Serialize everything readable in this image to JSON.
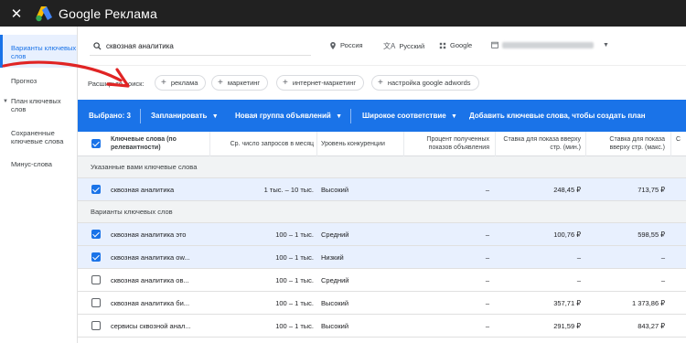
{
  "app": {
    "title": "Google Реклама"
  },
  "sidebar": {
    "items": [
      {
        "label": "Варианты ключевых слов",
        "active": true
      },
      {
        "label": "Прогноз"
      },
      {
        "label": "План ключевых слов"
      },
      {
        "label": "Сохраненные ключевые слова"
      },
      {
        "label": "Минус-слова"
      }
    ]
  },
  "search": {
    "query": "сквозная аналитика",
    "location": "Россия",
    "language": "Русский",
    "network": "Google"
  },
  "expand": {
    "label": "Расширьте поиск:",
    "chips": [
      "реклама",
      "маркетинг",
      "интернет-маркетинг",
      "настройка google adwords"
    ]
  },
  "toolbar": {
    "selected": "Выбрано: 3",
    "plan": "Запланировать",
    "new_group": "Новая группа объявлений",
    "match": "Широкое соответствие",
    "add_keywords": "Добавить ключевые слова, чтобы создать план"
  },
  "table": {
    "headers": {
      "keyword": "Ключевые слова (по релевантности)",
      "searches": "Ср. число запросов в месяц",
      "competition": "Уровень конкуренции",
      "impr_share": "Процент полученных показов объявления",
      "bid_low": "Ставка для показа вверху стр. (мин.)",
      "bid_high": "Ставка для показа вверху стр. (макс.)",
      "extra": "С"
    },
    "section_provided": "Указанные вами ключевые слова",
    "section_ideas": "Варианты ключевых слов",
    "provided": [
      {
        "checked": true,
        "keyword": "сквозная аналитика",
        "searches": "1 тыс. – 10 тыс.",
        "competition": "Высокий",
        "impr": "–",
        "low": "248,45 ₽",
        "high": "713,75 ₽"
      }
    ],
    "ideas": [
      {
        "checked": true,
        "keyword": "сквозная аналитика это",
        "searches": "100 – 1 тыс.",
        "competition": "Средний",
        "impr": "–",
        "low": "100,76 ₽",
        "high": "598,55 ₽"
      },
      {
        "checked": true,
        "keyword": "сквозная аналитика ow...",
        "searches": "100 – 1 тыс.",
        "competition": "Низкий",
        "impr": "–",
        "low": "–",
        "high": "–"
      },
      {
        "checked": false,
        "keyword": "сквозная аналитика ов...",
        "searches": "100 – 1 тыс.",
        "competition": "Средний",
        "impr": "–",
        "low": "–",
        "high": "–"
      },
      {
        "checked": false,
        "keyword": "сквозная аналитика би...",
        "searches": "100 – 1 тыс.",
        "competition": "Высокий",
        "impr": "–",
        "low": "357,71 ₽",
        "high": "1 373,86 ₽"
      },
      {
        "checked": false,
        "keyword": "сервисы сквозной анал...",
        "searches": "100 – 1 тыс.",
        "competition": "Высокий",
        "impr": "–",
        "low": "291,59 ₽",
        "high": "843,27 ₽"
      }
    ]
  },
  "colors": {
    "appbar": "#212121",
    "accent": "#1a73e8",
    "selected_row": "#e8f0fe",
    "annotation_arrow": "#e02424"
  }
}
